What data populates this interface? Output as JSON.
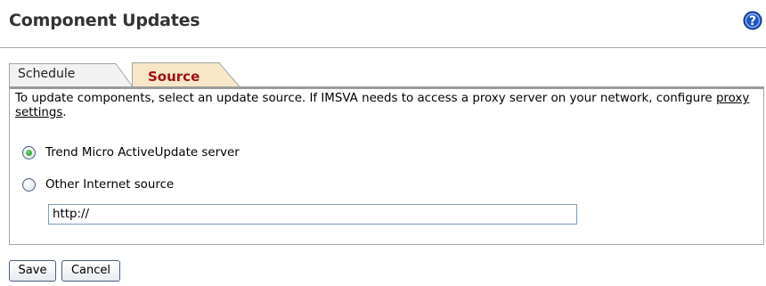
{
  "header": {
    "title": "Component Updates",
    "help_icon": "help-icon",
    "help_color": "#1e56c4"
  },
  "tabs": [
    {
      "label": "Schedule",
      "active": false
    },
    {
      "label": "Source",
      "active": true
    }
  ],
  "description": {
    "text_before": "To update components, select an update source. If IMSVA needs to access a proxy server on your network, configure ",
    "link_text": "proxy settings",
    "text_after": "."
  },
  "source_options": [
    {
      "label": "Trend Micro ActiveUpdate server",
      "selected": true
    },
    {
      "label": "Other Internet source",
      "selected": false
    }
  ],
  "url_input": {
    "value": "http://"
  },
  "buttons": {
    "save_label": "Save",
    "cancel_label": "Cancel"
  }
}
